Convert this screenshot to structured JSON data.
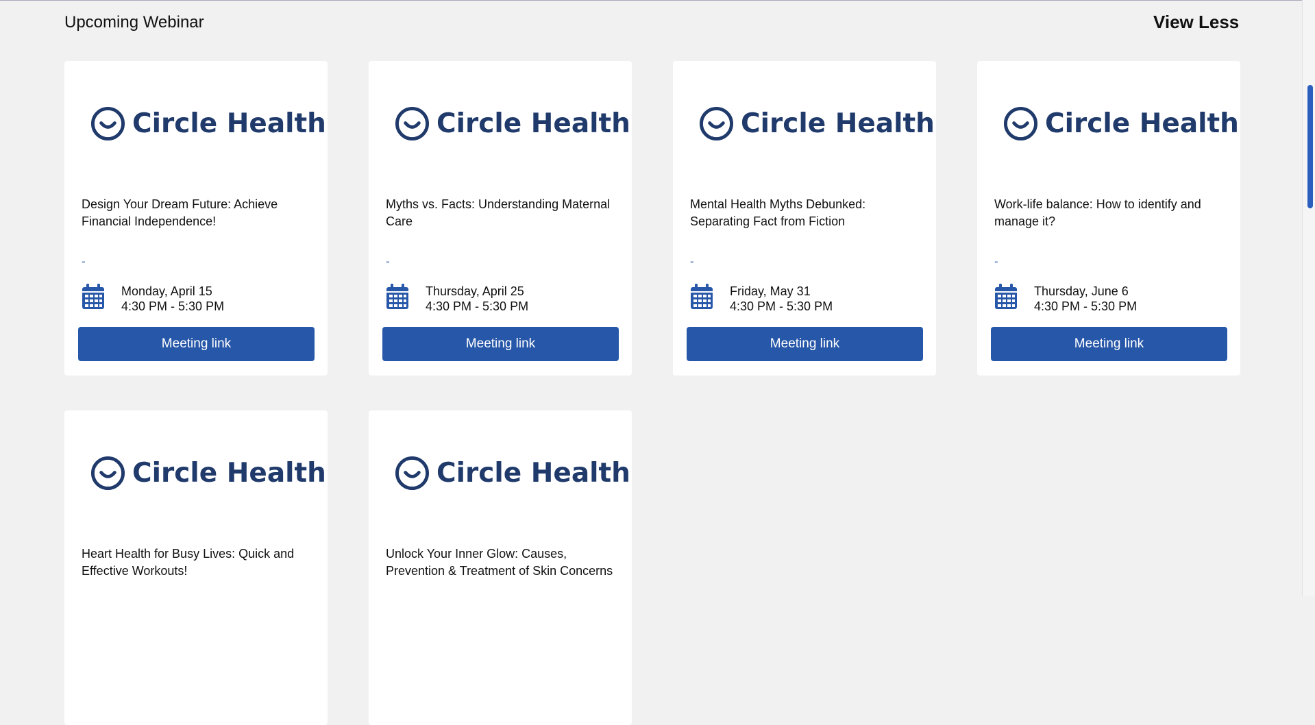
{
  "section": {
    "title": "Upcoming Webinar",
    "view_less_label": "View Less"
  },
  "brand": {
    "logo_text": "Circle Health",
    "logo_color": "#1f3a6b",
    "button_color": "#2757a8",
    "icon": "circle-smile-icon"
  },
  "webinars": [
    {
      "title": "Design Your Dream Future: Achieve Financial Independence!",
      "dash": "-",
      "date": "Monday, April 15",
      "time": "4:30 PM - 5:30 PM",
      "button_label": "Meeting link"
    },
    {
      "title": "Myths vs. Facts: Understanding Maternal Care",
      "dash": "-",
      "date": "Thursday, April 25",
      "time": "4:30 PM - 5:30 PM",
      "button_label": "Meeting link"
    },
    {
      "title": "Mental Health Myths Debunked: Separating Fact from Fiction",
      "dash": "-",
      "date": "Friday, May 31",
      "time": "4:30 PM - 5:30 PM",
      "button_label": "Meeting link"
    },
    {
      "title": "Work-life balance: How to identify and manage it?",
      "dash": "-",
      "date": "Thursday, June 6",
      "time": "4:30 PM - 5:30 PM",
      "button_label": "Meeting link"
    },
    {
      "title": "Heart Health for Busy Lives: Quick and Effective Workouts!"
    },
    {
      "title": "Unlock Your Inner Glow: Causes, Prevention & Treatment of Skin Concerns"
    }
  ]
}
